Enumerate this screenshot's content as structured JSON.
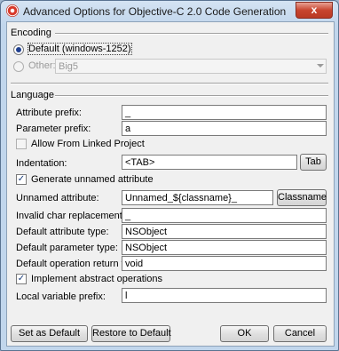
{
  "window": {
    "title": "Advanced Options for Objective-C 2.0 Code Generation",
    "close": "x"
  },
  "encoding": {
    "heading": "Encoding",
    "default_label": "Default (windows-1252)",
    "other_label": "Other:",
    "other_value": "Big5"
  },
  "language": {
    "heading": "Language",
    "attribute_prefix": {
      "label": "Attribute prefix:",
      "value": "_"
    },
    "parameter_prefix": {
      "label": "Parameter prefix:",
      "value": "a"
    },
    "allow_linked": {
      "label": "Allow From Linked Project"
    },
    "indentation": {
      "label": "Indentation:",
      "value": "<TAB>",
      "button": "Tab"
    },
    "generate_unnamed": {
      "label": "Generate unnamed attribute"
    },
    "unnamed_attribute": {
      "label": "Unnamed attribute:",
      "value": "Unnamed_${classname}_",
      "button": "Classname"
    },
    "invalid_char": {
      "label": "Invalid char replacement:",
      "value": "_"
    },
    "default_attr_type": {
      "label": "Default attribute type:",
      "value": "NSObject"
    },
    "default_param_type": {
      "label": "Default parameter type:",
      "value": "NSObject"
    },
    "default_return_type": {
      "label": "Default operation return type:",
      "value": "void"
    },
    "implement_abstract": {
      "label": "Implement abstract operations"
    },
    "local_var_prefix": {
      "label": "Local variable prefix:",
      "value": "l"
    }
  },
  "footer": {
    "set_default": "Set as Default",
    "restore_default": "Restore to Default",
    "ok": "OK",
    "cancel": "Cancel"
  }
}
